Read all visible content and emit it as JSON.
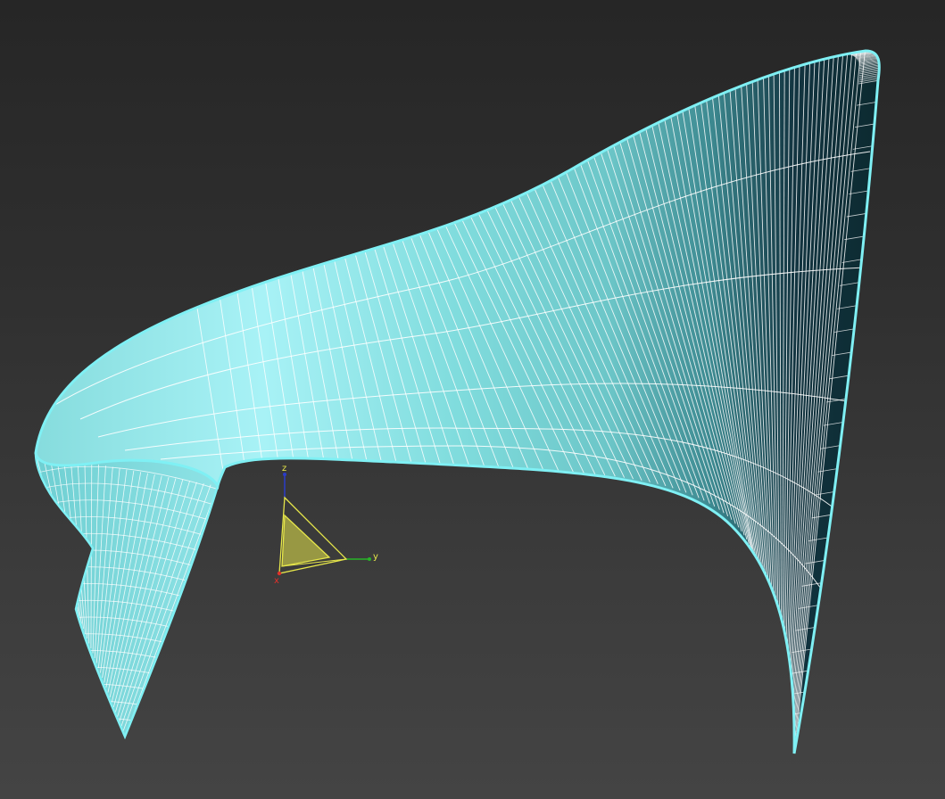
{
  "viewport": {
    "background_top": "#262626",
    "background_bottom": "#444444"
  },
  "surface": {
    "object": "swept surface",
    "fill_light": "#a8f2f6",
    "fill_mid": "#7fd6d8",
    "fill_dark": "#0c2a30",
    "edge_color": "#7ff0f4",
    "wire_color": "#ffffff",
    "selected": true
  },
  "gizmo": {
    "x_label": "x",
    "y_label": "y",
    "z_label": "z",
    "x_color": "#e0302a",
    "y_color": "#28b428",
    "z_color": "#2a3cc8",
    "plane_color": "#e6e64a"
  }
}
